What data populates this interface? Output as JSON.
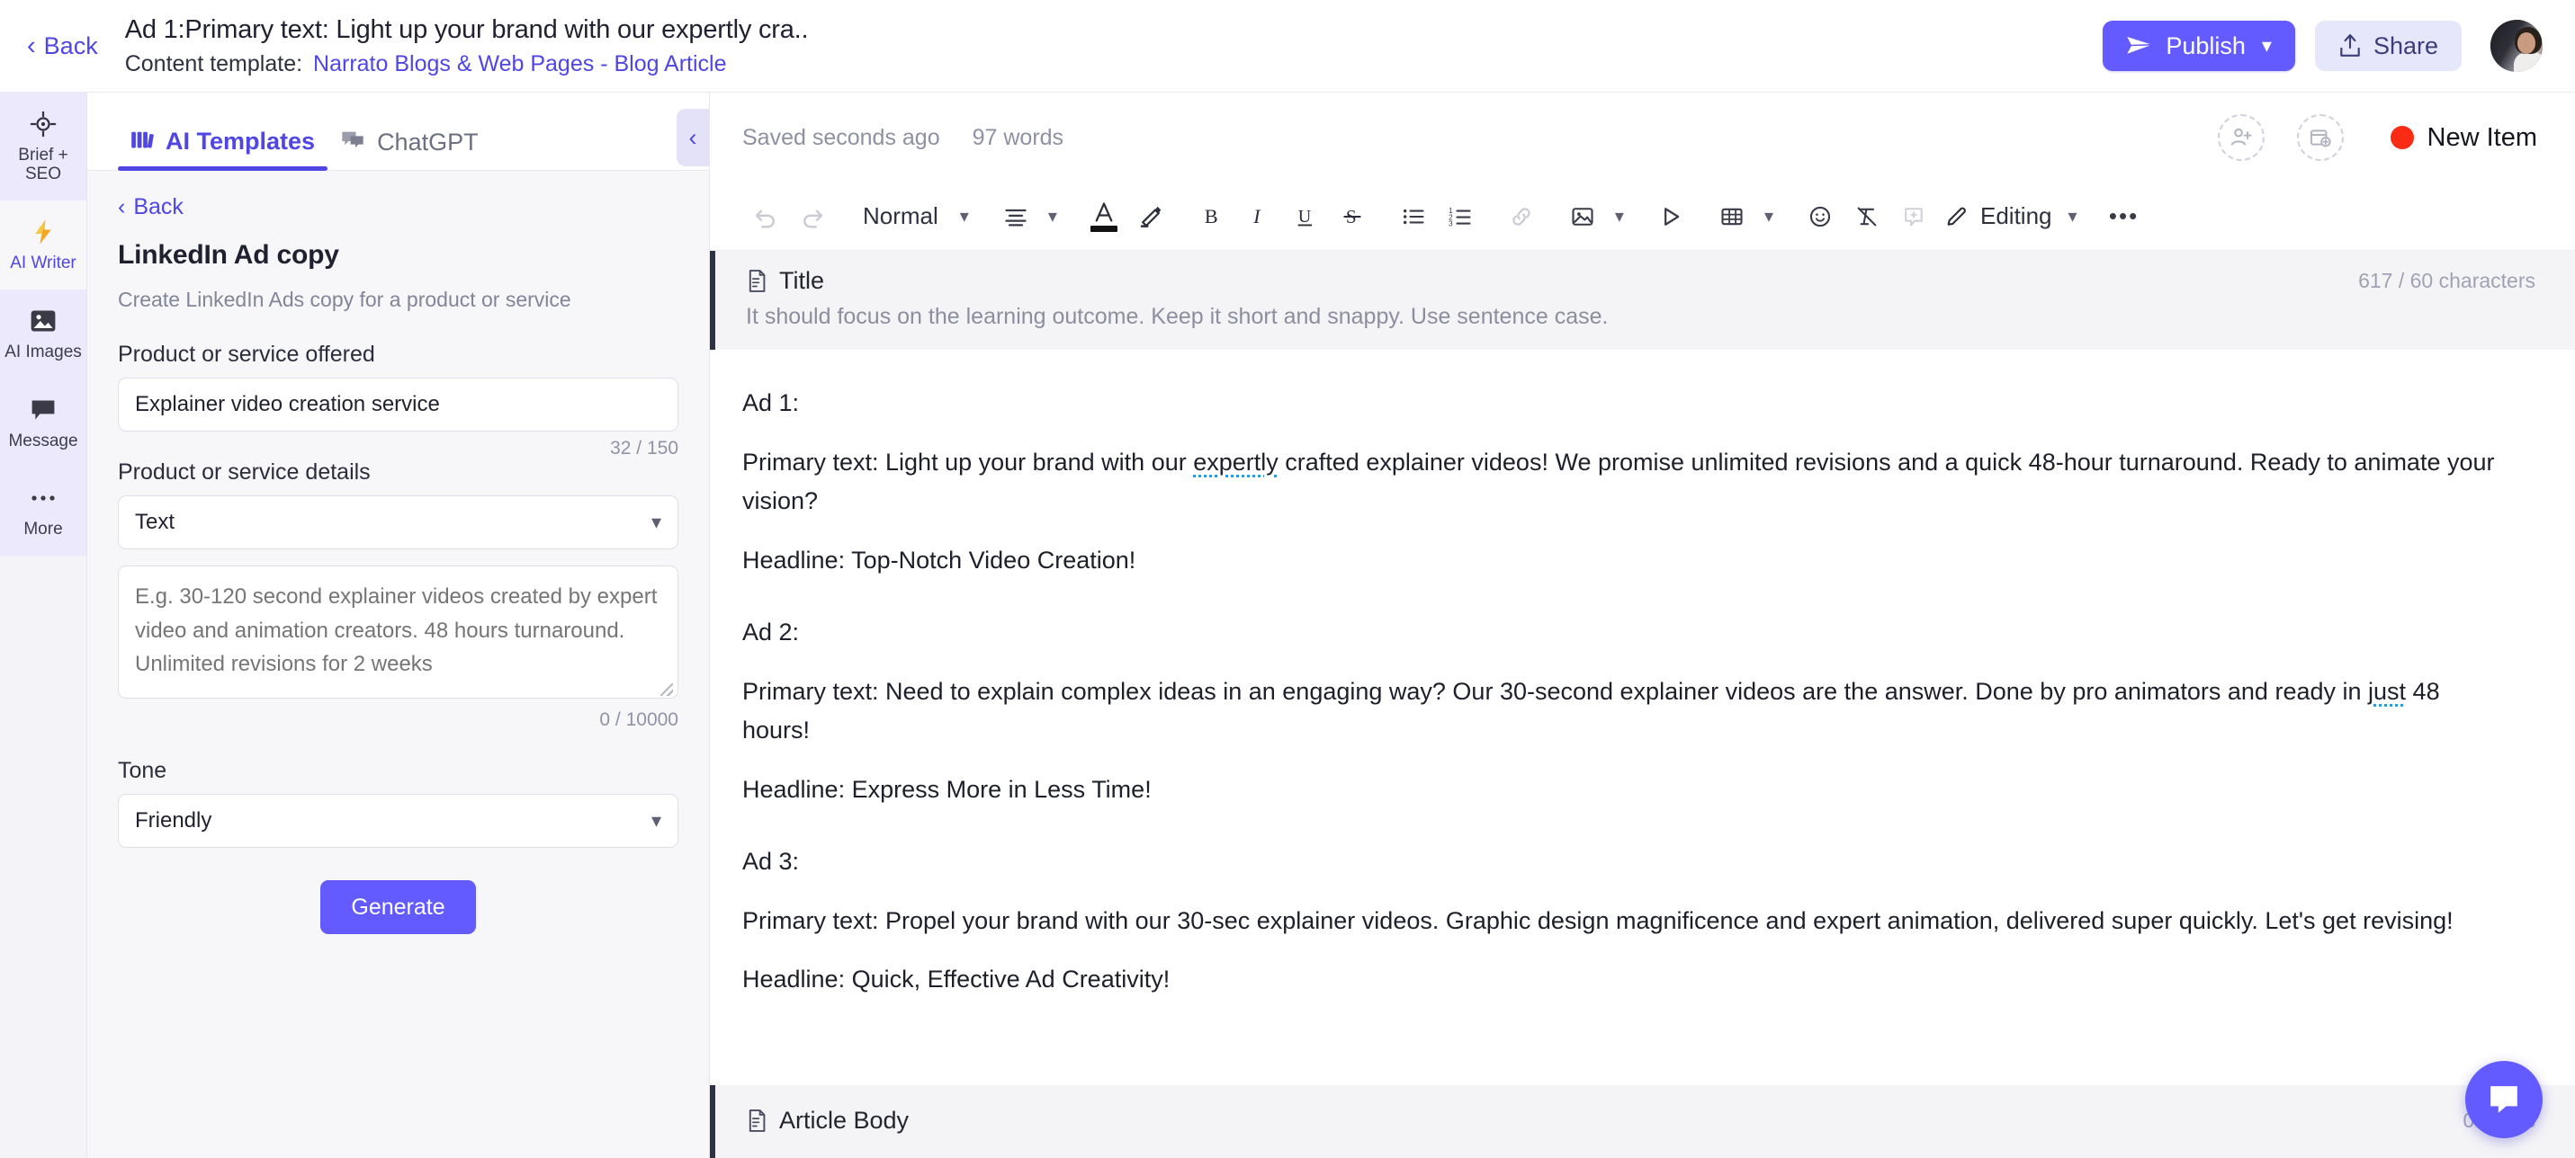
{
  "header": {
    "back_label": "Back",
    "doc_title": "Ad 1:Primary text: Light up your brand with our expertly cra..",
    "template_label": "Content template:",
    "template_value": "Narrato Blogs & Web Pages - Blog Article",
    "publish_label": "Publish",
    "share_label": "Share",
    "accent_purple": "#635bff",
    "link_purple": "#4f46e5"
  },
  "rail": {
    "items": [
      {
        "label": "Brief + SEO",
        "icon": "target-icon",
        "active": false
      },
      {
        "label": "AI Writer",
        "icon": "lightning-icon",
        "active": true
      },
      {
        "label": "AI Images",
        "icon": "image-icon",
        "active": false
      },
      {
        "label": "Message",
        "icon": "message-icon",
        "active": false
      },
      {
        "label": "More",
        "icon": "ellipsis-icon",
        "active": false
      }
    ]
  },
  "panel": {
    "tabs": [
      {
        "label": "AI Templates",
        "icon": "templates-icon",
        "active": true
      },
      {
        "label": "ChatGPT",
        "icon": "chat-icon",
        "active": false
      }
    ],
    "back_label": "Back",
    "title": "LinkedIn Ad copy",
    "description": "Create LinkedIn Ads copy for a product or service",
    "fields": {
      "product_label": "Product or service offered",
      "product_value": "Explainer video creation service",
      "product_placeholder": "Explainer video creation service",
      "product_counter": "32 / 150",
      "details_label": "Product or service details",
      "details_type_value": "Text",
      "details_placeholder": "E.g. 30-120 second explainer videos created by expert video and animation creators. 48 hours turnaround. Unlimited revisions for 2 weeks",
      "details_value": "",
      "details_counter": "0 / 10000",
      "tone_label": "Tone",
      "tone_value": "Friendly"
    },
    "generate_label": "Generate"
  },
  "editor": {
    "saved_text": "Saved seconds ago",
    "word_count": "97 words",
    "new_item_label": "New Item",
    "status_dot_color": "#fa2b15",
    "toolbar": {
      "undo": "undo-icon",
      "redo": "redo-icon",
      "style_value": "Normal",
      "editing_label": "Editing",
      "items": [
        "align-icon",
        "font-color-icon",
        "highlight-icon",
        "bold-icon",
        "italic-icon",
        "underline-icon",
        "strikethrough-icon",
        "bullet-list-icon",
        "numbered-list-icon",
        "link-icon",
        "image-icon",
        "video-icon",
        "table-icon",
        "emoji-icon",
        "clear-format-icon",
        "comment-icon",
        "more-icon"
      ]
    },
    "sections": [
      {
        "name": "Title",
        "counter": "617 / 60 characters",
        "hint": "It should focus on the learning outcome. Keep it short and snappy. Use sentence case."
      },
      {
        "name": "Article Body",
        "counter": "0 words",
        "hint": ""
      }
    ],
    "content": [
      {
        "text": "Ad 1:",
        "gap": false
      },
      {
        "text": "Primary text: Light up your brand with our ",
        "misspelled": "expertly",
        "text_after": " crafted explainer videos! We promise unlimited revisions and a quick 48-hour turnaround. Ready to animate your vision?",
        "gap": false
      },
      {
        "text": "Headline: Top-Notch Video Creation!",
        "gap": true
      },
      {
        "text": "Ad 2:",
        "gap": false
      },
      {
        "text": "Primary text: Need to explain complex ideas in an engaging way? Our 30-second explainer videos are the answer. Done by pro animators and ready in ",
        "misspelled": "just",
        "text_after": " 48 hours!",
        "gap": false
      },
      {
        "text": "Headline: Express More in Less Time!",
        "gap": true
      },
      {
        "text": "Ad 3:",
        "gap": false
      },
      {
        "text": "Primary text: Propel your brand with our 30-sec explainer videos. Graphic design magnificence and expert animation, delivered super quickly. Let's get revising!",
        "gap": false
      },
      {
        "text": "Headline: Quick, Effective Ad Creativity!",
        "gap": true
      }
    ]
  }
}
